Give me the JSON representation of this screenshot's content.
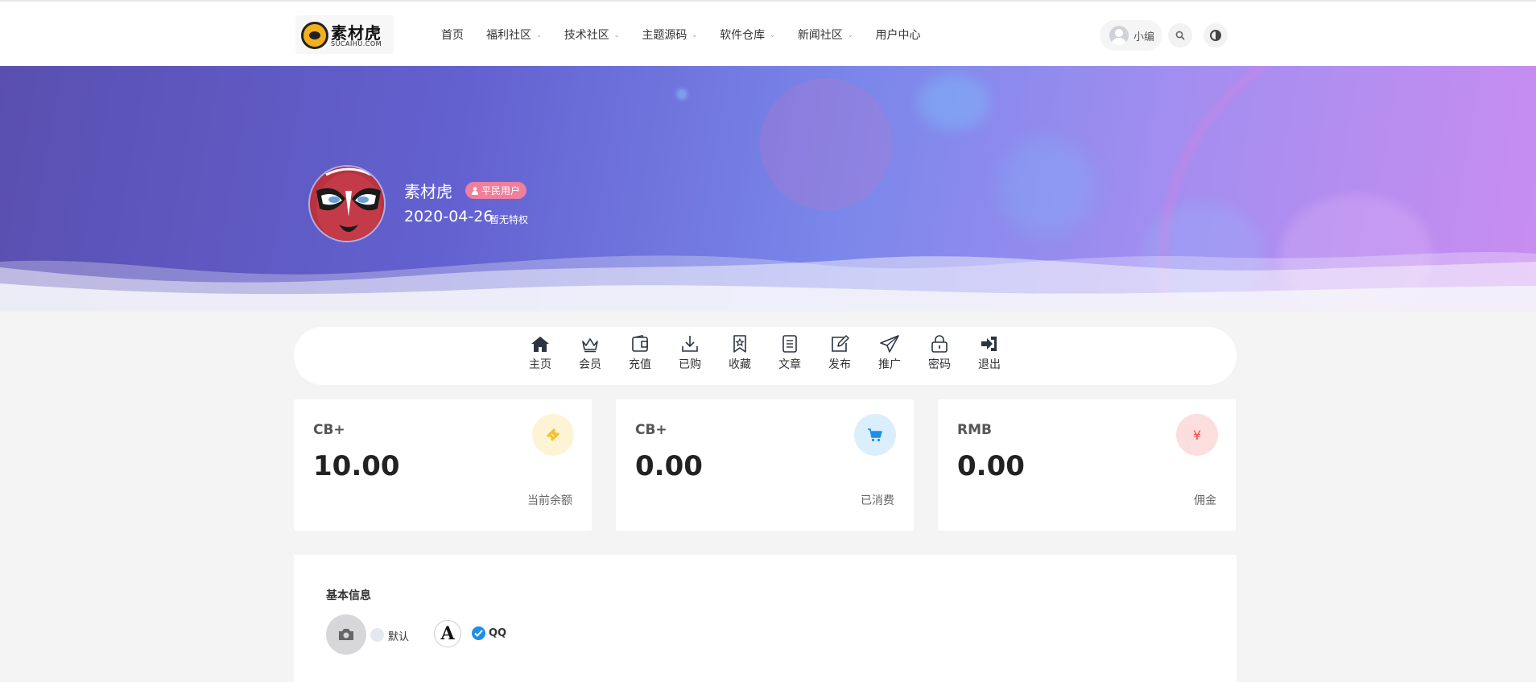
{
  "header": {
    "logo_text": "素材虎",
    "logo_sub": "SUCAIHU.COM",
    "nav": [
      {
        "label": "首页",
        "has_dropdown": false
      },
      {
        "label": "福利社区",
        "has_dropdown": true
      },
      {
        "label": "技术社区",
        "has_dropdown": true
      },
      {
        "label": "主题源码",
        "has_dropdown": true
      },
      {
        "label": "软件仓库",
        "has_dropdown": true
      },
      {
        "label": "新闻社区",
        "has_dropdown": true
      },
      {
        "label": "用户中心",
        "has_dropdown": false
      }
    ],
    "user_name": "小编",
    "search_icon": "search-icon",
    "theme_icon": "theme-toggle-icon"
  },
  "profile": {
    "name": "素材虎",
    "badge": "平民用户",
    "reg_date": "2020-04-26",
    "privilege": "暂无特权"
  },
  "toolbar": [
    {
      "label": "主页",
      "icon": "home-icon"
    },
    {
      "label": "会员",
      "icon": "crown-icon"
    },
    {
      "label": "充值",
      "icon": "wallet-icon"
    },
    {
      "label": "已购",
      "icon": "download-icon"
    },
    {
      "label": "收藏",
      "icon": "bookmark-star-icon"
    },
    {
      "label": "文章",
      "icon": "document-icon"
    },
    {
      "label": "发布",
      "icon": "edit-icon"
    },
    {
      "label": "推广",
      "icon": "paper-plane-icon"
    },
    {
      "label": "密码",
      "icon": "lock-icon"
    },
    {
      "label": "退出",
      "icon": "sign-out-icon"
    }
  ],
  "stats": [
    {
      "unit": "CB+",
      "value": "10.00",
      "caption": "当前余额",
      "icon": "ticket-icon",
      "color": "#f6c02c",
      "bg": "#fdf4d6"
    },
    {
      "unit": "CB+",
      "value": "0.00",
      "caption": "已消费",
      "icon": "cart-icon",
      "color": "#1e8ee6",
      "bg": "#dbeefb"
    },
    {
      "unit": "RMB",
      "value": "0.00",
      "caption": "佣金",
      "icon": "yen-icon",
      "color": "#ef4b4b",
      "bg": "#fcdede"
    }
  ],
  "info": {
    "title": "基本信息",
    "avatar_options": [
      {
        "label": "默认",
        "selected": false
      },
      {
        "label": "QQ",
        "selected": true
      }
    ]
  },
  "colors": {
    "badge": "#ef7f9c",
    "accent": "#1e8ee6"
  }
}
